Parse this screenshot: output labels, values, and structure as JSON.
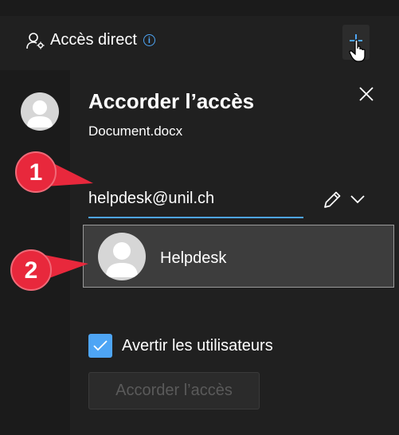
{
  "header": {
    "direct_access_label": "Accès direct",
    "info_icon": "info-icon",
    "add_icon": "add-people-icon"
  },
  "panel": {
    "title": "Accorder l’accès",
    "subtitle": "Document.docx",
    "email_value": "helpdesk@unil.ch",
    "suggestion_name": "Helpdesk",
    "notify_label": "Avertir les utilisateurs",
    "notify_checked": true,
    "grant_button_label": "Accorder l’accès"
  },
  "callouts": [
    {
      "number": "1"
    },
    {
      "number": "2"
    }
  ],
  "colors": {
    "accent": "#4ea5f5",
    "callout": "#e8283c",
    "background": "#1b1b1b",
    "panel": "#202020"
  }
}
